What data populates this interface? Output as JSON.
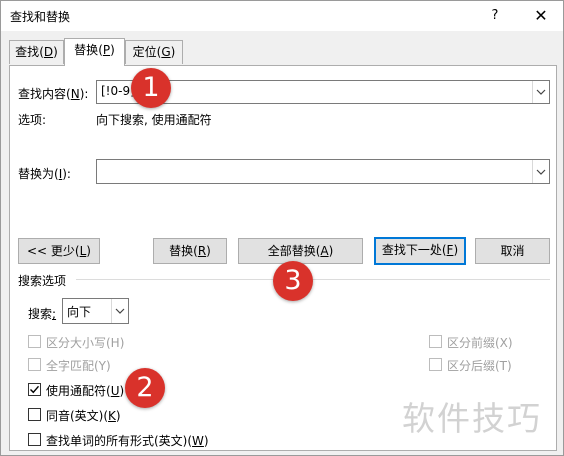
{
  "window": {
    "title": "查找和替换",
    "help": "?",
    "close": "✕"
  },
  "tabs": [
    {
      "label": "查找",
      "key": "D"
    },
    {
      "label": "替换",
      "key": "P"
    },
    {
      "label": "定位",
      "key": "G"
    }
  ],
  "find": {
    "label": "查找内容",
    "key": "N",
    "value": "[!0-9]"
  },
  "options_line": {
    "label": "选项:",
    "value": "向下搜索, 使用通配符"
  },
  "replace": {
    "label": "替换为",
    "key": "I",
    "value": ""
  },
  "buttons": {
    "less": {
      "prefix": "<< 更少(",
      "key": "L",
      "suffix": ")"
    },
    "replace": {
      "prefix": "替换(",
      "key": "R",
      "suffix": ")"
    },
    "replace_all": {
      "prefix": "全部替换(",
      "key": "A",
      "suffix": ")"
    },
    "find_next": {
      "prefix": "查找下一处(",
      "key": "F",
      "suffix": ")"
    },
    "cancel": "取消"
  },
  "search_options": {
    "header": "搜索选项",
    "search_label": "搜索",
    "search_key": ";",
    "search_value": "向下",
    "left_checks": [
      {
        "label": "区分大小写(H)",
        "checked": false,
        "enabled": false
      },
      {
        "label": "全字匹配(Y)",
        "checked": false,
        "enabled": false
      },
      {
        "prefix": "使用通配符(",
        "key": "U",
        "suffix": ")",
        "checked": true,
        "enabled": true
      },
      {
        "prefix": "同音(英文)(",
        "key": "K",
        "suffix": ")",
        "checked": false,
        "enabled": true
      },
      {
        "prefix": "查找单词的所有形式(英文)(",
        "key": "W",
        "suffix": ")",
        "checked": false,
        "enabled": true
      }
    ],
    "right_checks": [
      {
        "label": "区分前缀(X)",
        "checked": false,
        "enabled": false
      },
      {
        "label": "区分后缀(T)",
        "checked": false,
        "enabled": false
      }
    ]
  },
  "annotations": [
    "1",
    "2",
    "3"
  ],
  "watermark": "软件技巧",
  "colors": {
    "badge": "#d9322b",
    "default_button_border": "#0078d7"
  }
}
